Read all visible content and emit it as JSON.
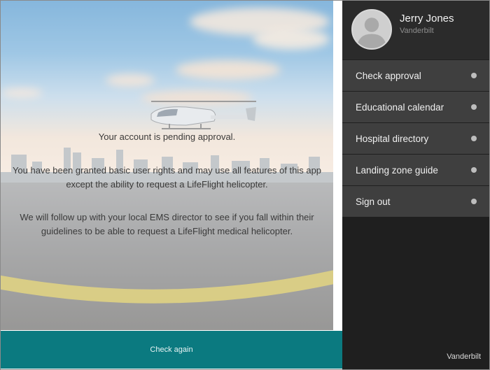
{
  "main": {
    "status_title": "Your account is pending approval.",
    "rights_message": "You have been granted basic user rights and may use all features of this app except the ability to request a LifeFlight helicopter.",
    "followup_message": "We will follow up with your local EMS director to see if you fall within their guidelines to be able to request a LifeFlight medical helicopter.",
    "check_again_label": "Check again",
    "accent_color": "#0b7a80"
  },
  "sidebar": {
    "user": {
      "name": "Jerry Jones",
      "organization": "Vanderbilt",
      "avatar_icon": "user-silhouette-icon"
    },
    "items": [
      {
        "label": "Check approval",
        "indicator_icon": "dot-icon"
      },
      {
        "label": "Educational calendar",
        "indicator_icon": "dot-icon"
      },
      {
        "label": "Hospital directory",
        "indicator_icon": "dot-icon"
      },
      {
        "label": "Landing zone guide",
        "indicator_icon": "dot-icon"
      },
      {
        "label": "Sign out",
        "indicator_icon": "dot-icon"
      }
    ],
    "footer_brand": "Vanderbilt"
  }
}
